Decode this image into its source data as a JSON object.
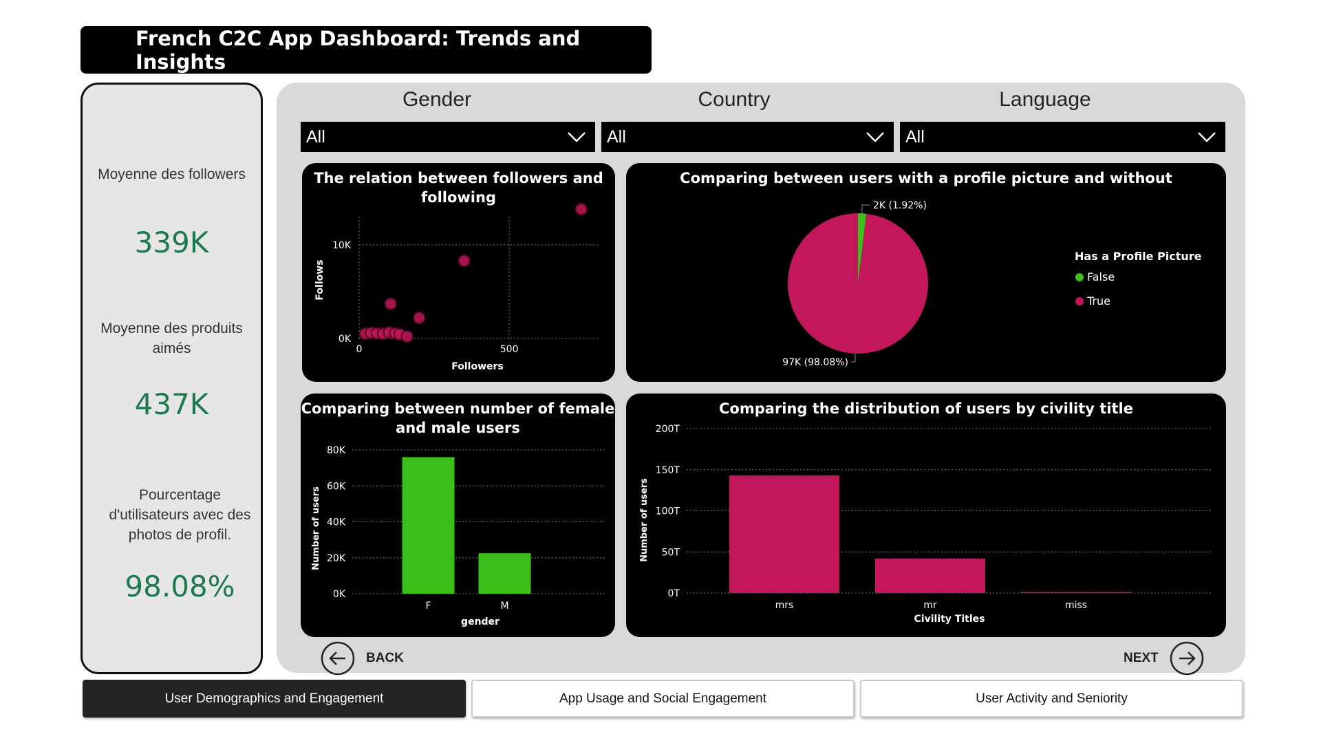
{
  "title": "French C2C App Dashboard: Trends and Insights",
  "kpis": {
    "followers_label": "Moyenne des followers",
    "followers_value": "339K",
    "liked_label_1": "Moyenne des produits",
    "liked_label_2": "aimés",
    "liked_value": "437K",
    "photo_label_1": "Pourcentage",
    "photo_label_2": "d'utilisateurs avec des",
    "photo_label_3": "photos de profil.",
    "photo_value": "98.08%"
  },
  "slicers": [
    {
      "title": "Gender",
      "value": "All"
    },
    {
      "title": "Country",
      "value": "All"
    },
    {
      "title": "Language",
      "value": "All"
    }
  ],
  "colors": {
    "pink": "#c2185b",
    "green": "#3cbf1a",
    "accent_text": "#1e7a4e"
  },
  "chart_data": [
    {
      "type": "scatter",
      "title_line1": "The relation between followers and",
      "title_line2": "following",
      "xlabel": "Followers",
      "ylabel": "Follows",
      "x_ticks": [
        "0",
        "500"
      ],
      "y_ticks": [
        "0K",
        "10K"
      ],
      "xlim": [
        0,
        800
      ],
      "ylim": [
        0,
        13000
      ],
      "points": [
        {
          "x": 740,
          "y": 13800
        },
        {
          "x": 350,
          "y": 8300
        },
        {
          "x": 105,
          "y": 3700
        },
        {
          "x": 200,
          "y": 2200
        },
        {
          "x": 20,
          "y": 500
        },
        {
          "x": 40,
          "y": 600
        },
        {
          "x": 60,
          "y": 550
        },
        {
          "x": 80,
          "y": 500
        },
        {
          "x": 100,
          "y": 650
        },
        {
          "x": 120,
          "y": 550
        },
        {
          "x": 135,
          "y": 450
        },
        {
          "x": 160,
          "y": 200
        }
      ]
    },
    {
      "type": "pie",
      "title": "Comparing between users with a profile picture and without",
      "legend_title": "Has a Profile Picture",
      "legend_position": "right",
      "slices": [
        {
          "label": "False",
          "value": 1.92,
          "data_label": "2K (1.92%)"
        },
        {
          "label": "True",
          "value": 98.08,
          "data_label": "97K (98.08%)"
        }
      ]
    },
    {
      "type": "bar",
      "title_line1": "Comparing between number of female",
      "title_line2": "and male users",
      "categories": [
        "F",
        "M"
      ],
      "values": [
        76000,
        22500
      ],
      "xlabel": "gender",
      "ylabel": "Number of users",
      "y_ticks": [
        "0K",
        "20K",
        "40K",
        "60K",
        "80K"
      ],
      "ylim": [
        0,
        80000
      ]
    },
    {
      "type": "bar",
      "title": "Comparing the distribution of users by civility title",
      "categories": [
        "mrs",
        "mr",
        "miss"
      ],
      "values": [
        143,
        42,
        1
      ],
      "xlabel": "Civility Titles",
      "ylabel": "Number of users",
      "y_ticks": [
        "0T",
        "50T",
        "100T",
        "150T",
        "200T"
      ],
      "ylim": [
        0,
        200
      ]
    }
  ],
  "nav": {
    "back": "BACK",
    "next": "NEXT"
  },
  "tabs": [
    {
      "label": "User Demographics and Engagement"
    },
    {
      "label": "App Usage and Social Engagement"
    },
    {
      "label": "User Activity and Seniority"
    }
  ]
}
